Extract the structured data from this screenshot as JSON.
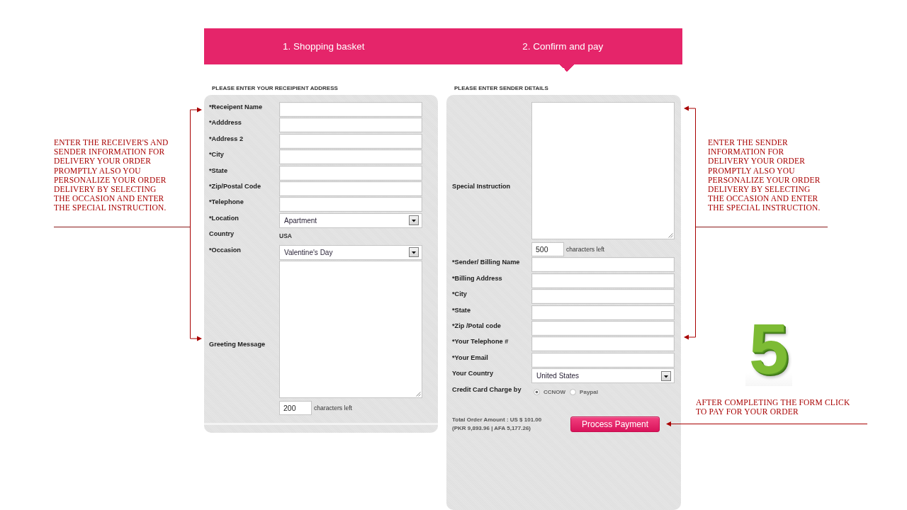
{
  "steps": [
    {
      "label": "1. Shopping basket",
      "selected": false
    },
    {
      "label": "2. Confirm and pay",
      "selected": true
    }
  ],
  "left_note": {
    "lines": [
      "ENTER THE RECEIVER'S AND",
      "SENDER INFORMATION FOR",
      "DELIVERY YOUR ORDER",
      "PROMPTLY ALSO YOU",
      "PERSONALIZE YOUR ORDER",
      "DELIVERY BY SELECTING",
      "THE OCCASION AND ENTER",
      "THE SPECIAL INSTRUCTION."
    ]
  },
  "recipient": {
    "heading": "PLEASE ENTER YOUR RECEIPIENT ADDRESS",
    "fields": [
      {
        "kind": "text",
        "label": "*Receipent Name"
      },
      {
        "kind": "text",
        "label": "*Adddress"
      },
      {
        "kind": "text",
        "label": "*Address 2"
      },
      {
        "kind": "text",
        "label": "*City"
      },
      {
        "kind": "text",
        "label": "*State"
      },
      {
        "kind": "text",
        "label": "*Zip/Postal Code"
      },
      {
        "kind": "text",
        "label": "*Telephone"
      },
      {
        "kind": "select",
        "label": "*Location",
        "value": "Apartment"
      },
      {
        "kind": "static",
        "label": "Country",
        "value": "USA"
      },
      {
        "kind": "select",
        "label": "*Occasion",
        "value": "Valentine's Day"
      },
      {
        "kind": "textarea",
        "label": "Greeting Message",
        "counter": "200",
        "counter_label": "characters left"
      }
    ]
  },
  "sender": {
    "heading": "PLEASE ENTER SENDER DETAILS",
    "fields": [
      {
        "kind": "textarea",
        "label": "Special Instruction",
        "counter": "500",
        "counter_label": "characters left"
      },
      {
        "kind": "text",
        "label": "*Sender/ Billing Name"
      },
      {
        "kind": "text",
        "label": "*Billing Address"
      },
      {
        "kind": "text",
        "label": "*City"
      },
      {
        "kind": "text",
        "label": "*State"
      },
      {
        "kind": "text",
        "label": "*Zip /Potal code"
      },
      {
        "kind": "text",
        "label": "*Your Telephone #"
      },
      {
        "kind": "text",
        "label": "*Your Email"
      },
      {
        "kind": "select",
        "label": "Your Country",
        "value": "United States"
      },
      {
        "kind": "radio",
        "label": "Credit Card Charge by",
        "options": [
          {
            "label": "CCNOW",
            "selected": true
          },
          {
            "label": "Paypal",
            "selected": false
          }
        ]
      }
    ],
    "total": "Total Order Amount : US $ 101.00",
    "total_converted": "(PKR 9,893.96 | AFA 5,177.26)",
    "submit": "Process Payment"
  },
  "right_note": {
    "lines": [
      "ENTER THE SENDER",
      "INFORMATION FOR",
      "DELIVERY YOUR ORDER",
      "PROMPTLY ALSO YOU",
      "PERSONALIZE YOUR ORDER",
      "DELIVERY BY SELECTING",
      "THE OCCASION AND ENTER",
      "THE SPECIAL INSTRUCTION."
    ]
  },
  "step_number": "5",
  "payment_note": {
    "lines": [
      "AFTER COMPLETING THE FORM CLICK",
      "TO PAY FOR YOUR ORDER"
    ]
  }
}
